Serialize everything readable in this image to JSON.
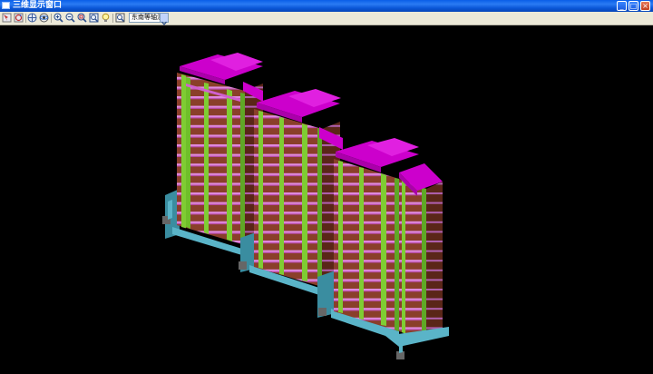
{
  "window": {
    "title": "三维显示窗口",
    "buttons": {
      "minimize": "_",
      "maximize": "□",
      "close": "×"
    }
  },
  "toolbar": {
    "icons": [
      "select-icon",
      "rotate-icon",
      "pan-icon",
      "orbit-icon",
      "zoom-in-icon",
      "zoom-out-icon",
      "zoom-window-icon",
      "zoom-extents-icon",
      "lightbulb-icon",
      "properties-icon"
    ],
    "view_select": {
      "value": "东南等轴测"
    }
  },
  "colors": {
    "roof": "#cc00cc",
    "wall_green": "#7fcc33",
    "slab_brown": "#8a4a2a",
    "foundation": "#5ab4c8",
    "background": "#000000"
  }
}
